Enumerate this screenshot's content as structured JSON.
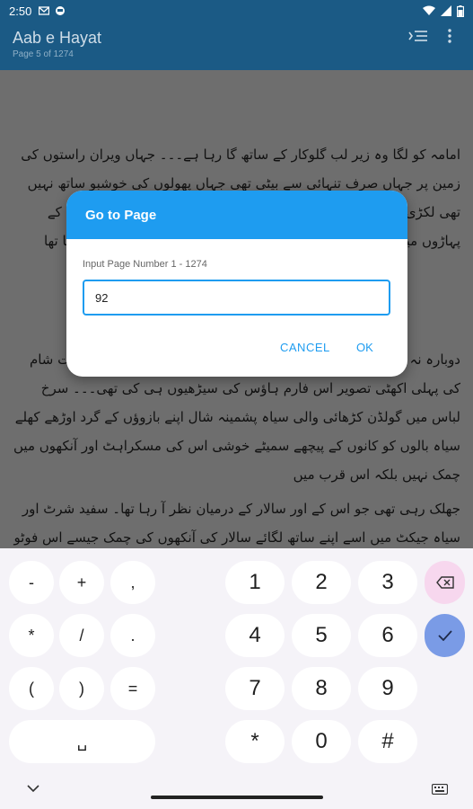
{
  "status_bar": {
    "time": "2:50",
    "icons": [
      "gmail-icon",
      "shield-icon"
    ],
    "right_icons": [
      "wifi-icon",
      "signal-icon",
      "battery-icon"
    ]
  },
  "app_bar": {
    "title": "Aab e Hayat",
    "subtitle": "Page 5 of 1274",
    "actions": [
      "table-of-contents-icon",
      "more-vert-icon"
    ]
  },
  "page": {
    "paragraph_1": "امامہ کو لگا وہ زیر لب گلوکار کے ساتھ گا رہا ہے۔۔۔ جہاں ویران راستوں کی زمین پر جہاں صرف تنہائی سے بیٹی تھی جہاں پھولوں کی خوشبو ساتھ نہیں تھی لکڑی کی ان سیڑھیوں پر جو بلندی پر بنائی گئی تھی جہاں پہاڑوں کے پہاڑوں میں گونج کی آواز تھی جہاں ہر بادل ایک کہانی کا حصہ بن رہا تھا",
    "paragraph_2": "دوبارہ نہ آنے کے لئے۔۔۔ وہ شاید اس کی زندگی کی سب سے خوبصورت شام کی پہلی اکھٹی تصویر اس فارم ہاؤس کی سیڑھیوں ہی کی تھی۔۔۔ سرخ لباس میں گولڈن کڑھائی والی سیاہ پشمینہ شال اپنے بازوؤں کے گرد اوڑھے کھلے سیاہ بالوں کو کانوں کے پیچھے سمیٹے خوشی اس کی مسکراہٹ اور آنکھوں میں چمک نہیں بلکہ اس قرب میں",
    "paragraph_3": "جھلک رہی تھی جو اس کے اور سالار کے درمیان نظر آ رہا تھا۔ سفید شرٹ اور سیاہ جیکٹ میں اسے اپنے ساتھ لگائے سالار کی آنکھوں کی چمک جیسے اس فوٹو گراف میں موجود دوسری ہر شے کو مات"
  },
  "dialog": {
    "title": "Go to Page",
    "label": "Input Page Number 1 - 1274",
    "input_value": "92",
    "cancel_label": "CANCEL",
    "ok_label": "OK",
    "accent_color": "#1e9cf0"
  },
  "keyboard": {
    "symbols": [
      "-",
      "+",
      ",",
      "*",
      "/",
      ".",
      "(",
      ")",
      "=",
      "␣"
    ],
    "digits": [
      "1",
      "2",
      "3",
      "4",
      "5",
      "6",
      "7",
      "8",
      "9",
      "*",
      "0",
      "#"
    ],
    "backspace_icon": "backspace-icon",
    "enter_icon": "check-icon"
  },
  "nav_bar": {
    "icons": [
      "chevron-down-icon",
      "keyboard-icon"
    ]
  }
}
